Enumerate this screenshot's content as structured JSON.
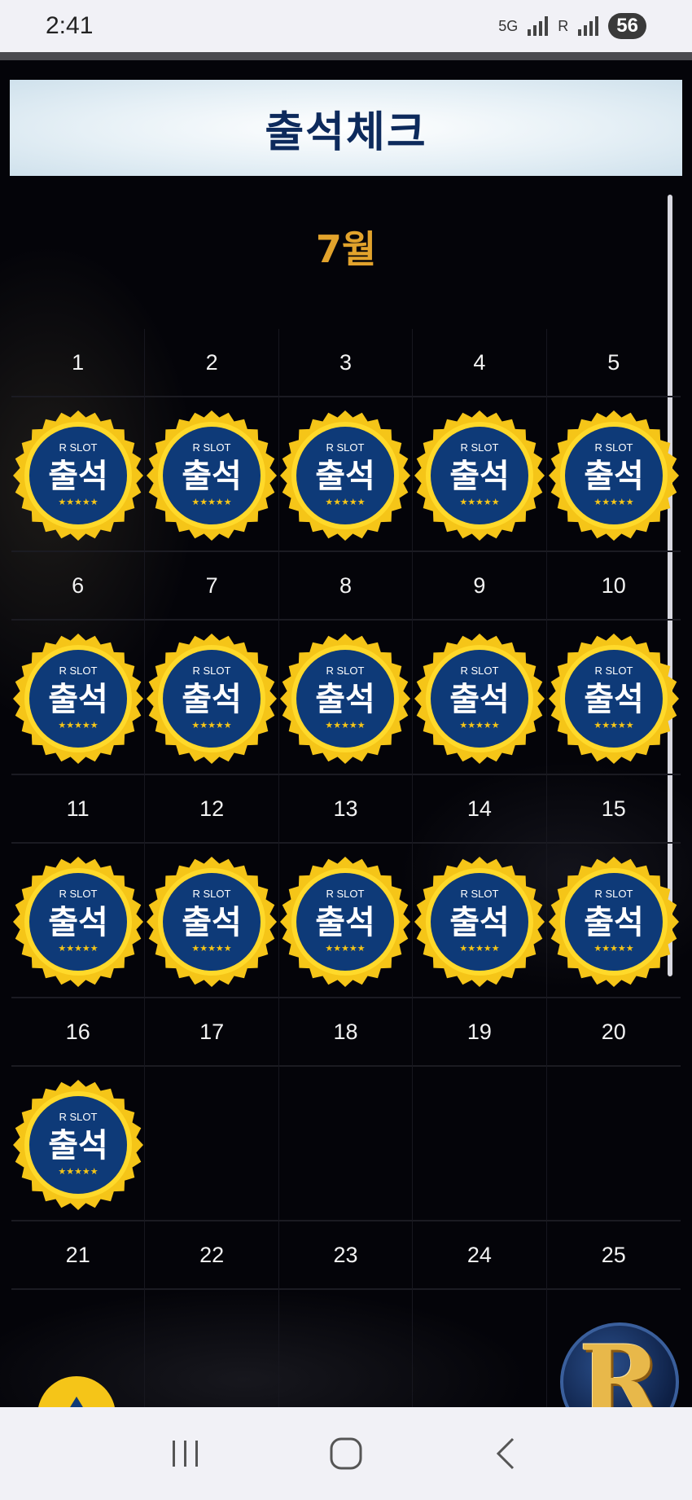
{
  "status_bar": {
    "time": "2:41",
    "network": "5G",
    "roaming": "R",
    "battery": "56"
  },
  "header": {
    "title": "출석체크"
  },
  "calendar": {
    "month": "7월",
    "days": [
      {
        "day": "1",
        "checked": true
      },
      {
        "day": "2",
        "checked": true
      },
      {
        "day": "3",
        "checked": true
      },
      {
        "day": "4",
        "checked": true
      },
      {
        "day": "5",
        "checked": true
      },
      {
        "day": "6",
        "checked": true
      },
      {
        "day": "7",
        "checked": true
      },
      {
        "day": "8",
        "checked": true
      },
      {
        "day": "9",
        "checked": true
      },
      {
        "day": "10",
        "checked": true
      },
      {
        "day": "11",
        "checked": true
      },
      {
        "day": "12",
        "checked": true
      },
      {
        "day": "13",
        "checked": true
      },
      {
        "day": "14",
        "checked": true
      },
      {
        "day": "15",
        "checked": true
      },
      {
        "day": "16",
        "checked": true
      },
      {
        "day": "17",
        "checked": false
      },
      {
        "day": "18",
        "checked": false
      },
      {
        "day": "19",
        "checked": false
      },
      {
        "day": "20",
        "checked": false
      },
      {
        "day": "21",
        "checked": false
      },
      {
        "day": "22",
        "checked": false
      },
      {
        "day": "23",
        "checked": false
      },
      {
        "day": "24",
        "checked": false
      },
      {
        "day": "25",
        "checked": false
      }
    ],
    "stamp": {
      "brand": "R SLOT",
      "label": "출석",
      "stars": "★★★★★"
    }
  },
  "floating": {
    "brand_letter": "R"
  },
  "colors": {
    "stamp_ring": "#f5c518",
    "stamp_center": "#0e3a78",
    "month_color": "#e2a32c",
    "header_text": "#0d2a5c"
  },
  "icons": {
    "scroll_top": "triangle-up-icon",
    "nav_recent": "recent-apps-icon",
    "nav_home": "home-icon",
    "nav_back": "back-icon"
  }
}
